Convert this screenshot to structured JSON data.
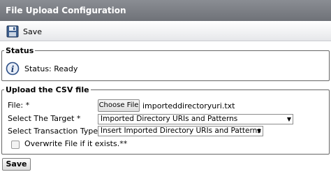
{
  "window": {
    "title": "File Upload Configuration"
  },
  "toolbar": {
    "save_label": "Save",
    "save_icon": "floppy-disk-icon"
  },
  "status": {
    "legend": "Status",
    "icon": "info-icon",
    "message": "Status: Ready"
  },
  "upload": {
    "legend": "Upload the CSV file",
    "file_label": "File:",
    "required_mark": "*",
    "choose_button": "Choose File",
    "file_name": "importeddirectoryuri.txt",
    "target_label": "Select The Target",
    "target_value": "Imported Directory URIs and Patterns",
    "transaction_label": "Select Transaction Type",
    "transaction_value": "Insert Imported Directory URIs and Patterns",
    "overwrite_label": "Overwrite File if it exists.**",
    "overwrite_checked": false
  },
  "footer": {
    "save_label": "Save"
  }
}
